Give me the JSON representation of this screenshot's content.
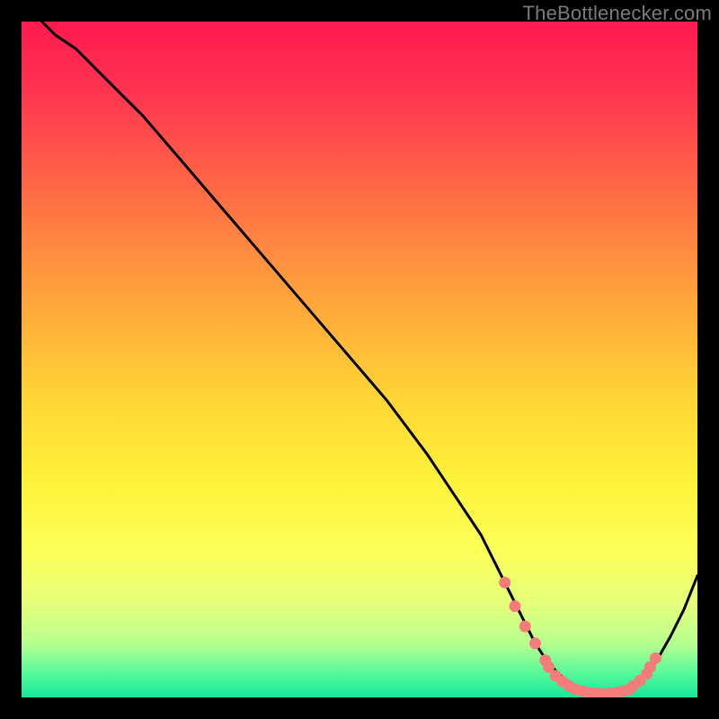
{
  "watermark": "TheBottlenecker.com",
  "colors": {
    "curve": "#000000",
    "marker": "#f67b7b",
    "frame_bg": "#000000"
  },
  "gradient_stops": [
    {
      "offset": 0.0,
      "color": "#ff1a4f"
    },
    {
      "offset": 0.1,
      "color": "#ff3350"
    },
    {
      "offset": 0.25,
      "color": "#ff6a45"
    },
    {
      "offset": 0.4,
      "color": "#ffa13c"
    },
    {
      "offset": 0.55,
      "color": "#ffd335"
    },
    {
      "offset": 0.68,
      "color": "#fff23a"
    },
    {
      "offset": 0.78,
      "color": "#fcff57"
    },
    {
      "offset": 0.86,
      "color": "#e6ff7a"
    },
    {
      "offset": 0.92,
      "color": "#b7ff8f"
    },
    {
      "offset": 0.965,
      "color": "#55f99a"
    },
    {
      "offset": 1.0,
      "color": "#17e69a"
    }
  ],
  "chart_data": {
    "type": "line",
    "title": "",
    "xlabel": "",
    "ylabel": "",
    "xlim": [
      0,
      100
    ],
    "ylim": [
      0,
      100
    ],
    "grid": false,
    "legend": false,
    "series": [
      {
        "name": "bottleneck-curve",
        "x": [
          3,
          5,
          8,
          12,
          18,
          24,
          30,
          36,
          42,
          48,
          54,
          60,
          64,
          68,
          71.5,
          74,
          76,
          78,
          80,
          82,
          84,
          86,
          88,
          90,
          92,
          94,
          96,
          98,
          100
        ],
        "values": [
          100,
          98,
          96,
          92,
          86,
          79,
          72,
          65,
          58,
          51,
          44,
          36,
          30,
          24,
          17,
          12,
          8,
          5,
          3,
          1.5,
          0.8,
          0.5,
          0.6,
          1.2,
          2.8,
          5.5,
          9,
          13,
          18
        ]
      }
    ],
    "markers": [
      {
        "x": 71.5,
        "y": 17
      },
      {
        "x": 73.0,
        "y": 13.5
      },
      {
        "x": 74.5,
        "y": 10.5
      },
      {
        "x": 76.0,
        "y": 8
      },
      {
        "x": 77.5,
        "y": 5.5
      },
      {
        "x": 78.0,
        "y": 4.5
      },
      {
        "x": 79.0,
        "y": 3.2
      },
      {
        "x": 80.0,
        "y": 2.4
      },
      {
        "x": 81.0,
        "y": 1.7
      },
      {
        "x": 82.0,
        "y": 1.2
      },
      {
        "x": 83.0,
        "y": 0.9
      },
      {
        "x": 84.0,
        "y": 0.7
      },
      {
        "x": 85.0,
        "y": 0.6
      },
      {
        "x": 86.0,
        "y": 0.5
      },
      {
        "x": 87.0,
        "y": 0.6
      },
      {
        "x": 88.0,
        "y": 0.7
      },
      {
        "x": 89.0,
        "y": 0.9
      },
      {
        "x": 89.8,
        "y": 1.1
      },
      {
        "x": 90.5,
        "y": 1.7
      },
      {
        "x": 91.5,
        "y": 2.5
      },
      {
        "x": 92.5,
        "y": 3.5
      },
      {
        "x": 93.0,
        "y": 4.5
      },
      {
        "x": 93.8,
        "y": 5.8
      }
    ]
  }
}
